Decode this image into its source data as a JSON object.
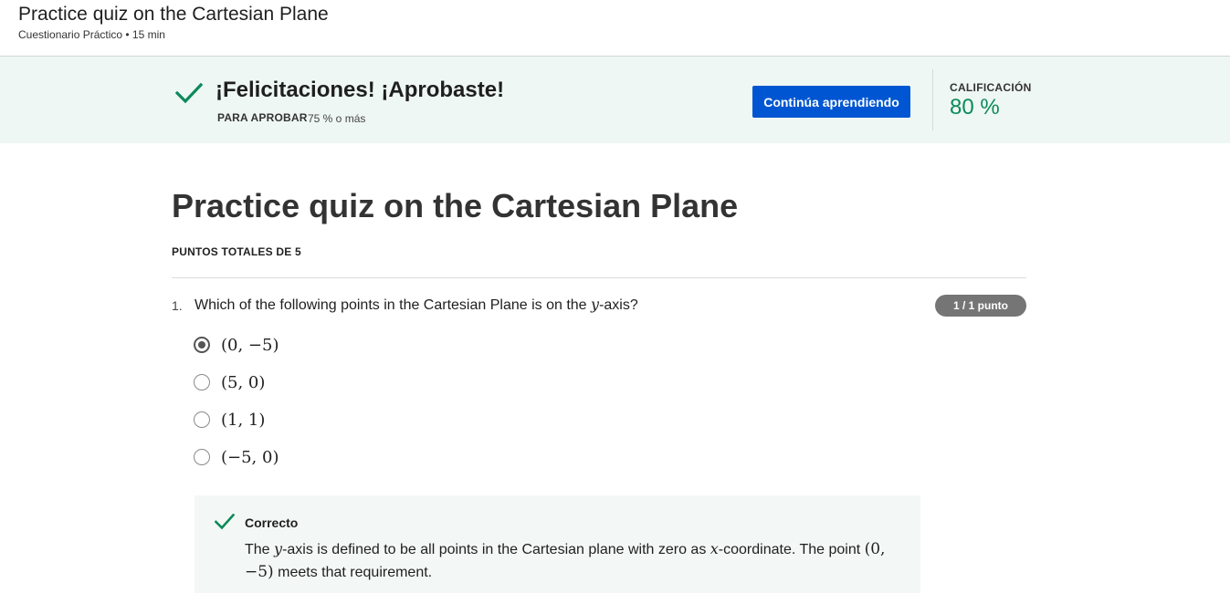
{
  "header": {
    "title": "Practice quiz on the Cartesian Plane",
    "subtitle": "Cuestionario Práctico • 15 min"
  },
  "banner": {
    "heading": "¡Felicitaciones! ¡Aprobaste!",
    "pass_label": "PARA APROBAR",
    "pass_value": "75 % o más",
    "continue_button": "Continúa aprendiendo",
    "grade_label": "CALIFICACIÓN",
    "grade_value": "80 %",
    "icon": "check-icon",
    "accent_color": "#0b8a5a"
  },
  "quiz": {
    "title": "Practice quiz on the Cartesian Plane",
    "total_points_label": "PUNTOS TOTALES DE 5"
  },
  "question": {
    "number": "1.",
    "text_before": "Which of the following points in the Cartesian Plane is on the ",
    "text_var": "y",
    "text_after": "-axis?",
    "score": "1 / 1 punto",
    "options": [
      {
        "label": "(0, −5)",
        "selected": true
      },
      {
        "label": "(5, 0)",
        "selected": false
      },
      {
        "label": "(1, 1)",
        "selected": false
      },
      {
        "label": "(−5, 0)",
        "selected": false
      }
    ]
  },
  "feedback": {
    "title": "Correcto",
    "t1": "The ",
    "v1": "y",
    "t2": "-axis is defined to be all points in the Cartesian plane with zero as ",
    "v2": "x",
    "t3": "-coordinate. The point ",
    "v3": "(0, −5)",
    "t4": " meets that requirement."
  },
  "colors": {
    "button": "#0056d2",
    "banner_bg": "#eef7f4",
    "feedback_bg": "#f3f8f6"
  }
}
